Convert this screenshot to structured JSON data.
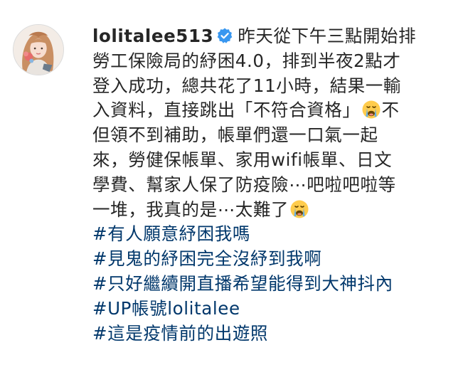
{
  "post": {
    "username": "lolitalee513",
    "verified_icon": "verified-badge-icon",
    "caption_lines": [
      "昨天從下午三點開始排",
      "勞工保險局的紓困4.0，排到半夜2點才",
      "登入成功，總共花了11小時，結果一輸",
      "入資料，直接跳出「不符合資格」",
      "不",
      "但領不到補助，帳單們還一口氣一起",
      "來，勞健保帳單、家用wifi帳單、日文",
      "學費、幫家人保了防疫險⋯吧啦吧啦等",
      "一堆，我真的是⋯太難了"
    ],
    "emojis": [
      "loudly-crying-face-icon",
      "loudly-crying-face-icon"
    ],
    "hashtags": [
      "#有人願意紓困我嗎",
      "#見鬼的紓困完全沒紓到我啊",
      "#只好繼續開直播希望能得到大神抖內",
      "#UP帳號lolitalee",
      "#這是疫情前的出遊照"
    ]
  },
  "colors": {
    "text": "#262626",
    "hashtag": "#00376b",
    "verified": "#3897f0"
  }
}
